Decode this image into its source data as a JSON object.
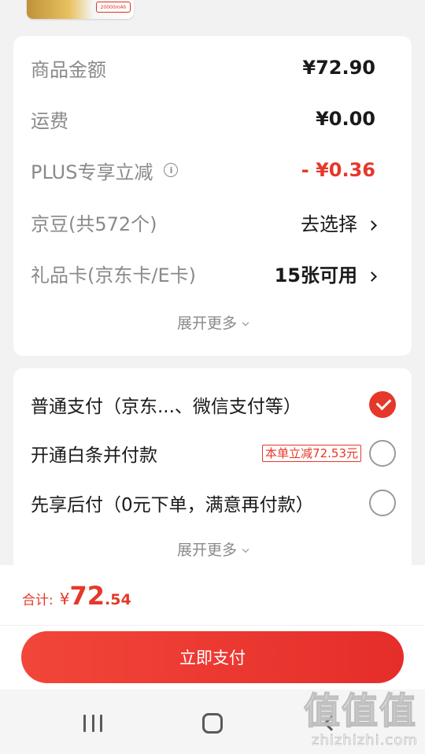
{
  "product_thumb": {
    "tag": "20000mAh"
  },
  "price_summary": {
    "rows": [
      {
        "label": "商品金额",
        "value": "¥72.90"
      },
      {
        "label": "运费",
        "value": "¥0.00"
      },
      {
        "label": "PLUS专享立减",
        "value": "- ¥0.36"
      },
      {
        "label": "京豆(共572个)",
        "value": "去选择"
      },
      {
        "label": "礼品卡(京东卡/E卡)",
        "value": "15张可用"
      }
    ],
    "expand_label": "展开更多"
  },
  "payment_methods": {
    "options": [
      {
        "label": "普通支付（京东...、微信支付等）",
        "selected": true
      },
      {
        "label": "开通白条并付款",
        "badge": "本单立减72.53元",
        "selected": false
      },
      {
        "label": "先享后付（0元下单，满意再付款）",
        "selected": false
      }
    ],
    "expand_label": "展开更多"
  },
  "footer": {
    "total_label": "合计:",
    "currency": "¥",
    "total_integer": "72",
    "total_decimal": ".54",
    "pay_button_label": "立即支付"
  },
  "watermark": {
    "glyph": "值",
    "text": "zhizhizhi.com"
  },
  "colors": {
    "accent": "#e5382b",
    "background": "#f2f2f2"
  }
}
